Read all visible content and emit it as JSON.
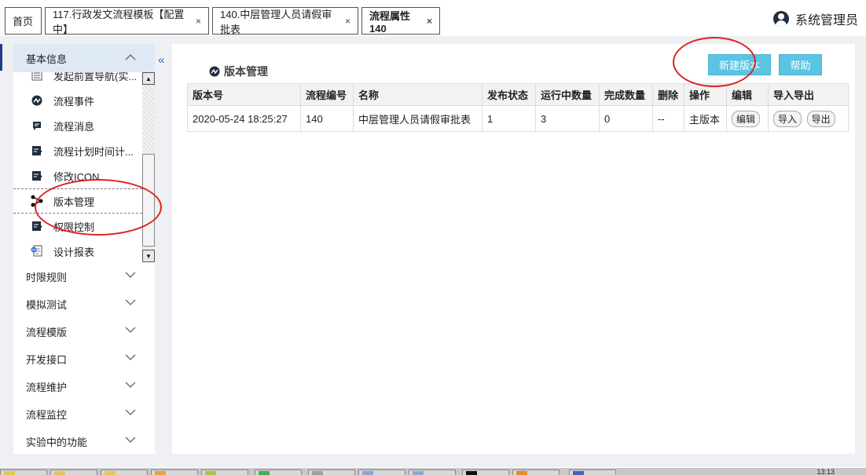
{
  "tabs": [
    {
      "label": "首页",
      "closable": false,
      "active": false
    },
    {
      "label": "117.行政发文流程模板【配置中】",
      "closable": true,
      "active": false
    },
    {
      "label": "140.中层管理人员请假审批表",
      "closable": true,
      "active": false
    },
    {
      "label": "流程属性140",
      "closable": true,
      "active": true
    }
  ],
  "close_glyph": "×",
  "user": {
    "name": "系统管理员",
    "icon": "user-circle-icon"
  },
  "sidebar": {
    "collapse_glyph": "«",
    "active_group": "基本信息",
    "sub_items": [
      {
        "label": "发起前置导航(实...",
        "icon": "list-icon"
      },
      {
        "label": "流程事件",
        "icon": "flow-event-icon"
      },
      {
        "label": "流程消息",
        "icon": "message-icon"
      },
      {
        "label": "流程计划时间计...",
        "icon": "edit-note-icon"
      },
      {
        "label": "修改ICON",
        "icon": "edit-note-icon"
      },
      {
        "label": "版本管理",
        "icon": "share-icon",
        "selected": true
      },
      {
        "label": "权限控制",
        "icon": "edit-note-icon"
      },
      {
        "label": "设计报表",
        "icon": "report-icon"
      }
    ],
    "groups": [
      "时限规则",
      "模拟测试",
      "流程模版",
      "开发接口",
      "流程维护",
      "流程监控",
      "实验中的功能"
    ]
  },
  "main": {
    "section_title": "版本管理",
    "buttons": {
      "new_version": "新建版本",
      "help": "帮助"
    },
    "table": {
      "headers": [
        "版本号",
        "流程编号",
        "名称",
        "发布状态",
        "运行中数量",
        "完成数量",
        "删除",
        "操作",
        "编辑",
        "导入导出"
      ],
      "rows": [
        {
          "version": "2020-05-24 18:25:27",
          "flow_no": "140",
          "name": "中层管理人员请假审批表",
          "publish_status": "1",
          "running": "3",
          "completed": "0",
          "deleted": "--",
          "operation": "主版本",
          "edit_label": "编辑",
          "import_label": "导入",
          "export_label": "导出"
        }
      ]
    }
  },
  "taskbar": {
    "clock": "13:13"
  },
  "colors": {
    "accent": "#5bc4e3",
    "sidebar_header": "#dfe8f5",
    "annotation": "#e02020"
  }
}
